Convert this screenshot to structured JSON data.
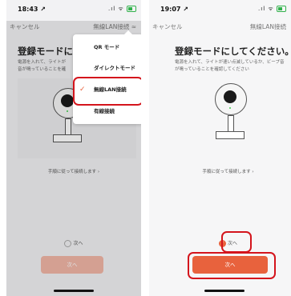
{
  "left_screen": {
    "status_time": "18:43 ↗",
    "signal": ".ıl ᯤ",
    "nav_cancel": "キャンセル",
    "nav_mode": "無線LAN接続 ≈",
    "title": "登録モードにして",
    "description": "電源を入れて、ライトが\n音が鳴っていることを確",
    "guide_link": "手順に従って接続します ›",
    "radio_label": "次へ",
    "next_button": "次へ",
    "menu": {
      "items": [
        {
          "label": "QR モード",
          "selected": false
        },
        {
          "label": "ダイレクトモード",
          "selected": false
        },
        {
          "label": "無線LAN接続",
          "selected": true
        },
        {
          "label": "有線接続",
          "selected": false
        }
      ],
      "check_icon": "✓"
    }
  },
  "right_screen": {
    "status_time": "19:07 ↗",
    "signal": ".ıl ᯤ",
    "nav_cancel": "キャンセル",
    "nav_mode": "無線LAN接続",
    "title": "登録モードにしてください。",
    "description": "電源を入れて、ライトが速い点滅しているか、ビープ音が鳴っていることを確認してください",
    "guide_link": "手順に従って接続します ›",
    "radio_label": "次へ",
    "radio_check": "✓",
    "next_button": "次へ"
  },
  "colors": {
    "accent": "#e8623d",
    "highlight": "#d4141c",
    "disabled_button": "#f2b7a7"
  }
}
